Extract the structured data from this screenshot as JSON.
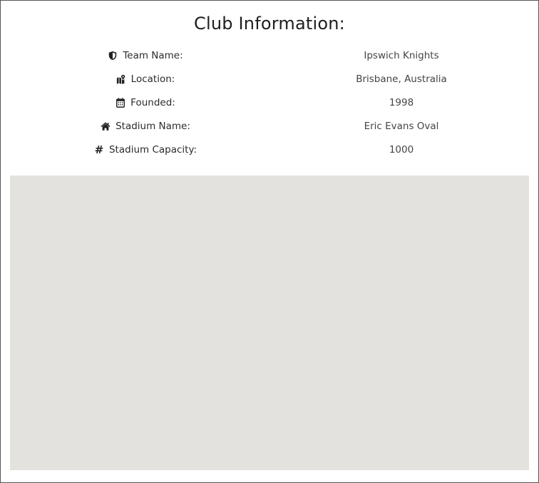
{
  "title": "Club Information:",
  "info": [
    {
      "icon": "shield-icon",
      "label": "Team Name:",
      "value": "Ipswich Knights"
    },
    {
      "icon": "map-location-icon",
      "label": "Location:",
      "value": "Brisbane, Australia"
    },
    {
      "icon": "calendar-icon",
      "label": "Founded:",
      "value": "1998"
    },
    {
      "icon": "home-icon",
      "label": "Stadium Name:",
      "value": "Eric Evans Oval"
    },
    {
      "icon": "hash-icon",
      "label": "Stadium Capacity:",
      "value": "1000"
    }
  ],
  "colors": {
    "map_background": "#e3e2de",
    "border": "#555555",
    "text": "#222222"
  }
}
